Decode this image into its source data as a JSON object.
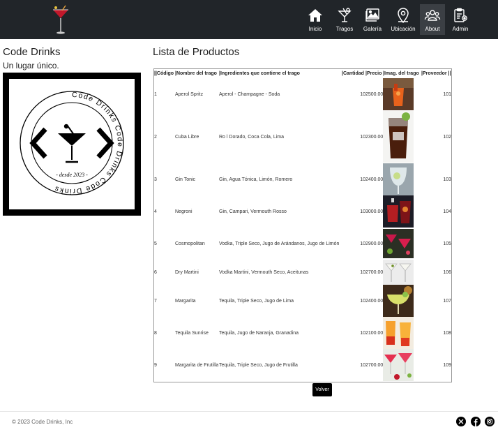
{
  "nav": {
    "items": [
      {
        "label": "Inicio",
        "icon": "home-icon"
      },
      {
        "label": "Tragos",
        "icon": "cocktail-glass-icon"
      },
      {
        "label": "Galería",
        "icon": "image-gallery-icon"
      },
      {
        "label": "Ubicación",
        "icon": "map-pin-icon"
      },
      {
        "label": "About",
        "icon": "people-icon"
      },
      {
        "label": "Admin",
        "icon": "admin-clipboard-icon"
      }
    ],
    "active": "About"
  },
  "sidebar": {
    "title": "Code Drinks",
    "subtitle": "Un lugar único.",
    "logo": {
      "ring_text": "Code Drinks   Code Drinks   Code Drinks",
      "center_text": "- desde 2023 -"
    }
  },
  "main": {
    "title": "Lista de Productos",
    "button": "Volver"
  },
  "table": {
    "headers": [
      "||Código",
      "|Nombre del trago",
      "|Ingredientes que contiene el trago",
      "|Cantidad",
      "|Precio",
      "|Imag. del trago",
      "|Proveedor ||"
    ],
    "rows": [
      {
        "codigo": "1",
        "nombre": "Aperol Spritz",
        "ingredientes": "Aperol - Champagne - Soda",
        "cantidad": "10",
        "precio": "2500.00",
        "proveedor": "101"
      },
      {
        "codigo": "2",
        "nombre": "Cuba Libre",
        "ingredientes": "Ro l Dorado, Coca Cola, Lima",
        "cantidad": "10",
        "precio": "2300.00",
        "proveedor": "102"
      },
      {
        "codigo": "3",
        "nombre": "Gin Tonic",
        "ingredientes": "Gin, Agua Tónica, Limón, Romero",
        "cantidad": "10",
        "precio": "2400.00",
        "proveedor": "103"
      },
      {
        "codigo": "4",
        "nombre": "Negroni",
        "ingredientes": "Gin, Campari, Vermouth Rosso",
        "cantidad": "10",
        "precio": "3000.00",
        "proveedor": "104"
      },
      {
        "codigo": "5",
        "nombre": "Cosmopolitan",
        "ingredientes": "Vodka, Triple Seco, Jugo de Arándanos, Jugo de Limón",
        "cantidad": "10",
        "precio": "2900.00",
        "proveedor": "105"
      },
      {
        "codigo": "6",
        "nombre": "Dry Martini",
        "ingredientes": "Vodka Martini, Vermouth Seco, Aceitunas",
        "cantidad": "10",
        "precio": "2700.00",
        "proveedor": "106"
      },
      {
        "codigo": "7",
        "nombre": "Margarita",
        "ingredientes": "Tequila, Triple Seco, Jugo de Lima",
        "cantidad": "10",
        "precio": "2400.00",
        "proveedor": "107"
      },
      {
        "codigo": "8",
        "nombre": "Tequila Sunrise",
        "ingredientes": "Tequila, Jugo de Naranja, Granadina",
        "cantidad": "10",
        "precio": "2100.00",
        "proveedor": "108"
      },
      {
        "codigo": "9",
        "nombre": "Margarita de Frutilla",
        "ingredientes": "Tequila, Triple Seco, Jugo de Frutilla",
        "cantidad": "10",
        "precio": "2700.00",
        "proveedor": "109"
      }
    ]
  },
  "footer": {
    "copyright": "© 2023 Code Drinks, Inc",
    "social": [
      "x-twitter-icon",
      "facebook-icon",
      "instagram-icon"
    ]
  }
}
